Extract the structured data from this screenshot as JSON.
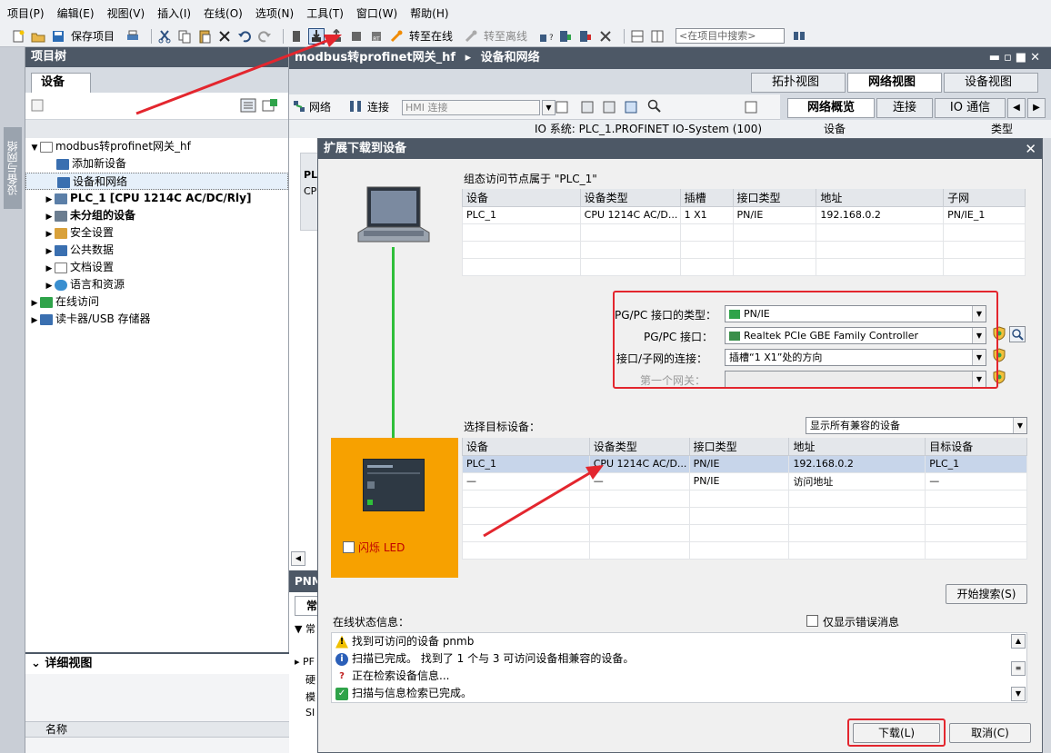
{
  "menu": [
    "项目(P)",
    "编辑(E)",
    "视图(V)",
    "插入(I)",
    "在线(O)",
    "选项(N)",
    "工具(T)",
    "窗口(W)",
    "帮助(H)"
  ],
  "toolbar": {
    "save_label": "保存项目",
    "go_online": "转至在线",
    "go_offline": "转至离线",
    "search_placeholder": "<在项目中搜索>"
  },
  "vertical_tab": "设备与网络",
  "tree": {
    "header": "项目树",
    "tab": "设备",
    "items": [
      {
        "label": "modbus转profinet网关_hf",
        "bold": false
      },
      {
        "label": "添加新设备",
        "bold": false
      },
      {
        "label": "设备和网络",
        "bold": false
      },
      {
        "label": "PLC_1 [CPU 1214C AC/DC/Rly]",
        "bold": true
      },
      {
        "label": "未分组的设备",
        "bold": true
      },
      {
        "label": "安全设置",
        "bold": false
      },
      {
        "label": "公共数据",
        "bold": false
      },
      {
        "label": "文档设置",
        "bold": false
      },
      {
        "label": "语言和资源",
        "bold": false
      },
      {
        "label": "在线访问",
        "bold": false
      },
      {
        "label": "读卡器/USB 存储器",
        "bold": false
      }
    ],
    "detail_header": "详细视图",
    "detail_column": "名称"
  },
  "editor": {
    "breadcrumb_project": "modbus转profinet网关_hf",
    "breadcrumb_sep": "▸",
    "breadcrumb_page": "设备和网络",
    "view_tabs": [
      "拓扑视图",
      "网络视图",
      "设备视图"
    ],
    "net_label": "网络",
    "conn_label": "连接",
    "hmi_conn": "HMI 连接",
    "io_system": "IO 系统: PLC_1.PROFINET IO-System (100)",
    "right_tabs": [
      "网络概览",
      "连接",
      "IO 通信"
    ],
    "right_sub_device": "设备",
    "right_sub_type": "类型",
    "canvas_plc": "PL",
    "canvas_cpu": "CP",
    "pnm": "PNM",
    "chang": "常",
    "pf": "PF",
    "ying": "硬",
    "mo": "模",
    "si": "SI"
  },
  "dialog": {
    "title": "扩展下载到设备",
    "config_label": "组态访问节点属于 \"PLC_1\"",
    "config_headers": [
      "设备",
      "设备类型",
      "插槽",
      "接口类型",
      "地址",
      "子网"
    ],
    "config_rows": [
      [
        "PLC_1",
        "CPU 1214C AC/D...",
        "1 X1",
        "PN/IE",
        "192.168.0.2",
        "PN/IE_1"
      ],
      [
        "",
        "",
        "",
        "",
        "",
        ""
      ],
      [
        "",
        "",
        "",
        "",
        "",
        ""
      ],
      [
        "",
        "",
        "",
        "",
        "",
        ""
      ]
    ],
    "pgpc_type_label": "PG/PC 接口的类型：",
    "pgpc_type_value": "PN/IE",
    "pgpc_if_label": "PG/PC 接口：",
    "pgpc_if_value": "Realtek PCIe GBE Family Controller",
    "conn_label": "接口/子网的连接：",
    "conn_value": "插槽“1 X1”处的方向",
    "gateway_label": "第一个网关：",
    "gateway_value": "",
    "target_label": "选择目标设备：",
    "target_filter": "显示所有兼容的设备",
    "target_headers": [
      "设备",
      "设备类型",
      "接口类型",
      "地址",
      "目标设备"
    ],
    "target_rows": [
      [
        "PLC_1",
        "CPU 1214C AC/D...",
        "PN/IE",
        "192.168.0.2",
        "PLC_1"
      ],
      [
        "—",
        "—",
        "PN/IE",
        "访问地址",
        "—"
      ],
      [
        "",
        "",
        "",
        "",
        ""
      ],
      [
        "",
        "",
        "",
        "",
        ""
      ],
      [
        "",
        "",
        "",
        "",
        ""
      ],
      [
        "",
        "",
        "",
        "",
        ""
      ]
    ],
    "flash_led": "闪烁 LED",
    "start_search": "开始搜索(S)",
    "status_label": "在线状态信息：",
    "errors_only": "仅显示错误消息",
    "status_lines": [
      {
        "icon": "warning",
        "text": "找到可访问的设备 pnmb"
      },
      {
        "icon": "info",
        "text": "扫描已完成。 找到了 1 个与 3 可访问设备相兼容的设备。"
      },
      {
        "icon": "search",
        "text": "正在检索设备信息..."
      },
      {
        "icon": "check",
        "text": "扫描与信息检索已完成。"
      }
    ],
    "download": "下载(L)",
    "cancel": "取消(C)"
  },
  "colors": {
    "title_bar": "#4d5866",
    "accent_red": "#e3262e",
    "orange_panel": "#f7a100",
    "network_line": "#2fbf3a"
  }
}
